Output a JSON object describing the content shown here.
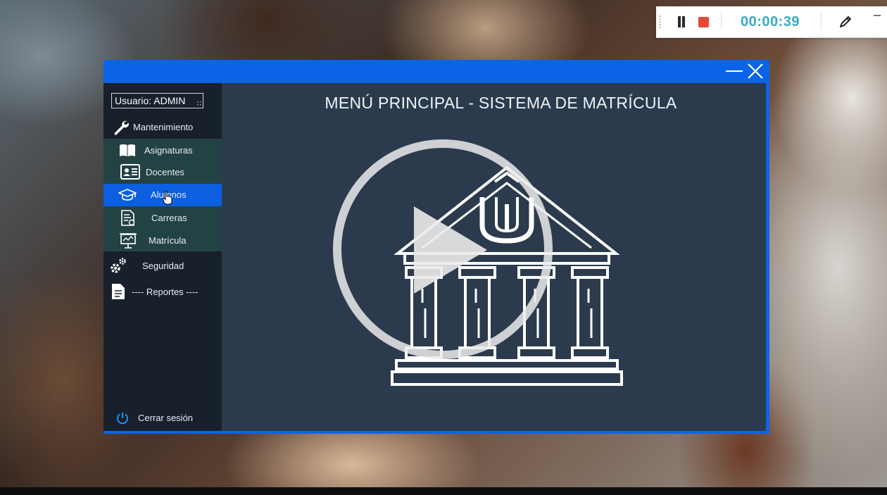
{
  "recorder": {
    "elapsed": "00:00:39",
    "icons": [
      "pause-icon",
      "stop-icon",
      "pen-icon",
      "minimize-icon"
    ],
    "colors": {
      "time": "#3aa9c8",
      "stop": "#e8483a"
    }
  },
  "window": {
    "controls": [
      "minimize-icon",
      "close-icon"
    ],
    "colors": {
      "frame": "#0b64e8",
      "sidebar": "#18202b",
      "submenu": "#234244",
      "active": "#0b5fe0",
      "main": "#2b3b4d"
    }
  },
  "sidebar": {
    "user_label": "Usuario: ADMIN",
    "menu": {
      "mantenimiento": {
        "label": "Mantenimiento",
        "icon": "wrench-icon"
      },
      "submenu": [
        {
          "label": "Asignaturas",
          "icon": "book-icon"
        },
        {
          "label": "Docentes",
          "icon": "id-card-icon"
        },
        {
          "label": "Alumnos",
          "icon": "graduation-cap-icon",
          "active": true
        },
        {
          "label": "Carreras",
          "icon": "document-icon"
        },
        {
          "label": "Matrícula",
          "icon": "presentation-board-icon"
        }
      ],
      "seguridad": {
        "label": "Seguridad",
        "icon": "gears-icon"
      },
      "reportes": {
        "label": "---- Reportes ----",
        "icon": "file-icon"
      }
    },
    "logout": {
      "label": "Cerrar sesión",
      "icon": "power-icon"
    }
  },
  "main": {
    "title": "MENÚ PRINCIPAL - SISTEMA DE MATRÍCULA",
    "logo_icon": "university-building-icon",
    "overlay_icon": "play-icon"
  }
}
